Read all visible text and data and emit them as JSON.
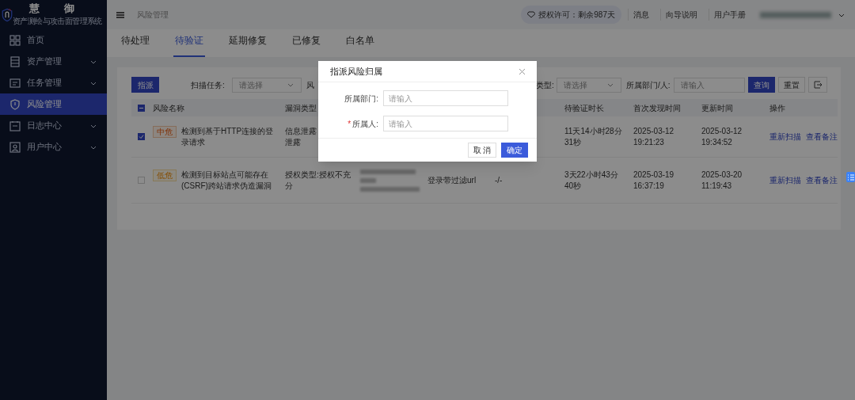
{
  "brand": {
    "title": "慧 御",
    "subtitle": "资产测绘与攻击面管理系统"
  },
  "sidebar": {
    "items": [
      {
        "label": "首页",
        "expandable": false,
        "selected": false
      },
      {
        "label": "资产管理",
        "expandable": true,
        "selected": false
      },
      {
        "label": "任务管理",
        "expandable": true,
        "selected": false
      },
      {
        "label": "风险管理",
        "expandable": false,
        "selected": true
      },
      {
        "label": "日志中心",
        "expandable": true,
        "selected": false
      },
      {
        "label": "用户中心",
        "expandable": true,
        "selected": false
      }
    ]
  },
  "topbar": {
    "breadcrumb": "风险管理",
    "license": "授权许可：剩余987天",
    "links": [
      "消息",
      "向导说明",
      "用户手册"
    ]
  },
  "tabs": [
    {
      "label": "待处理",
      "selected": false
    },
    {
      "label": "待验证",
      "selected": true
    },
    {
      "label": "延期修复",
      "selected": false
    },
    {
      "label": "已修复",
      "selected": false
    },
    {
      "label": "白名单",
      "selected": false
    }
  ],
  "filters": {
    "assign_button": "指派",
    "scan_task": {
      "label": "扫描任务:",
      "placeholder": "请选择"
    },
    "cut_label": "风",
    "vuln_type": {
      "label": "类型:",
      "placeholder": "请选择"
    },
    "owner": {
      "label": "所属部门/人:",
      "placeholder": "请输入"
    },
    "query": "查询",
    "reset": "重置"
  },
  "table": {
    "header_checkbox": {
      "indeterminate": true
    },
    "columns": [
      "风险名称",
      "漏洞类型",
      "待验证时长",
      "首次发现时间",
      "更新时间",
      "操作"
    ],
    "rows": [
      {
        "checked": true,
        "level": "中危",
        "kind": "medium",
        "name": "检测到基于HTTP连接的登录请求",
        "type_lines": [
          "信息泄露",
          "泄露"
        ],
        "duration": "11天14小时28分31秒",
        "first": "2025-03-12 19:21:23",
        "updated": "2025-03-12 19:34:52",
        "actions": [
          "重新扫描",
          "查看备注"
        ]
      },
      {
        "checked": false,
        "level": "低危",
        "kind": "low",
        "name": "检测到目标站点可能存在(CSRF)跨站请求伪造漏洞",
        "type_lines": [
          "授权类型:授权不充分"
        ],
        "col_e": "登录带过滤url",
        "col_f": "-/-",
        "duration": "3天22小时43分40秒",
        "first": "2025-03-19 16:37:19",
        "updated": "2025-03-20 11:19:43",
        "actions": [
          "重新扫描",
          "查看备注"
        ]
      }
    ]
  },
  "dialog": {
    "title": "指派风险归属",
    "fields": [
      {
        "label": "所属部门:",
        "placeholder": "请输入"
      },
      {
        "label": "所属人:",
        "placeholder": "请输入",
        "required_mark": "*"
      }
    ],
    "cancel": "取 消",
    "confirm": "确定"
  }
}
